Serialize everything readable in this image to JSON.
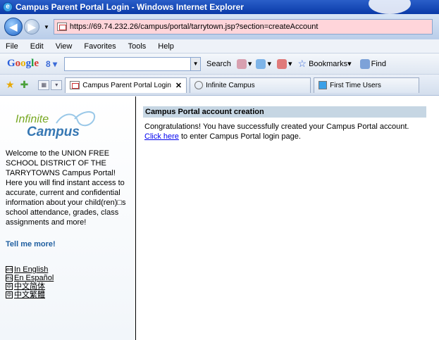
{
  "window": {
    "title": "Campus Parent Portal Login - Windows Internet Explorer"
  },
  "address_bar": {
    "url": "https://69.74.232.26/campus/portal/tarrytown.jsp?section=createAccount"
  },
  "menu": {
    "items": [
      "File",
      "Edit",
      "View",
      "Favorites",
      "Tools",
      "Help"
    ]
  },
  "google_toolbar": {
    "logo": [
      "G",
      "o",
      "o",
      "g",
      "l",
      "e"
    ],
    "search_label": "Search",
    "bookmarks_label": "Bookmarks",
    "find_label": "Find"
  },
  "tabs": [
    {
      "label": "Campus Parent Portal Login",
      "active": true,
      "close": "✕"
    },
    {
      "label": "Infinite Campus",
      "active": false
    },
    {
      "label": "First Time Users",
      "active": false
    }
  ],
  "sidebar": {
    "logo_line1": "Infinite",
    "logo_line2": "Campus",
    "welcome": "Welcome to the UNION FREE SCHOOL DISTRICT OF THE TARRYTOWNS Campus Portal! Here you will find instant access to accurate, current and confidential information about your child(ren)□s school attendance, grades, class assignments and more!",
    "tell_me_more": "Tell me more!",
    "languages": [
      {
        "flag": "en",
        "label": "In English"
      },
      {
        "flag": "es",
        "label": "En Español"
      },
      {
        "flag": "中",
        "label": "中文简体"
      },
      {
        "flag": "中",
        "label": "中文繁體"
      }
    ]
  },
  "main": {
    "heading": "Campus Portal account creation",
    "message_prefix": "Congratulations! You have successfully created your Campus Portal account. ",
    "link_text": "Click here",
    "message_suffix": " to enter Campus Portal login page."
  },
  "colors": {
    "title_bar": "#0a3aa8",
    "address_bg": "#ffd5da",
    "heading_bg": "#c6d6e3",
    "link": "#0000ee"
  }
}
